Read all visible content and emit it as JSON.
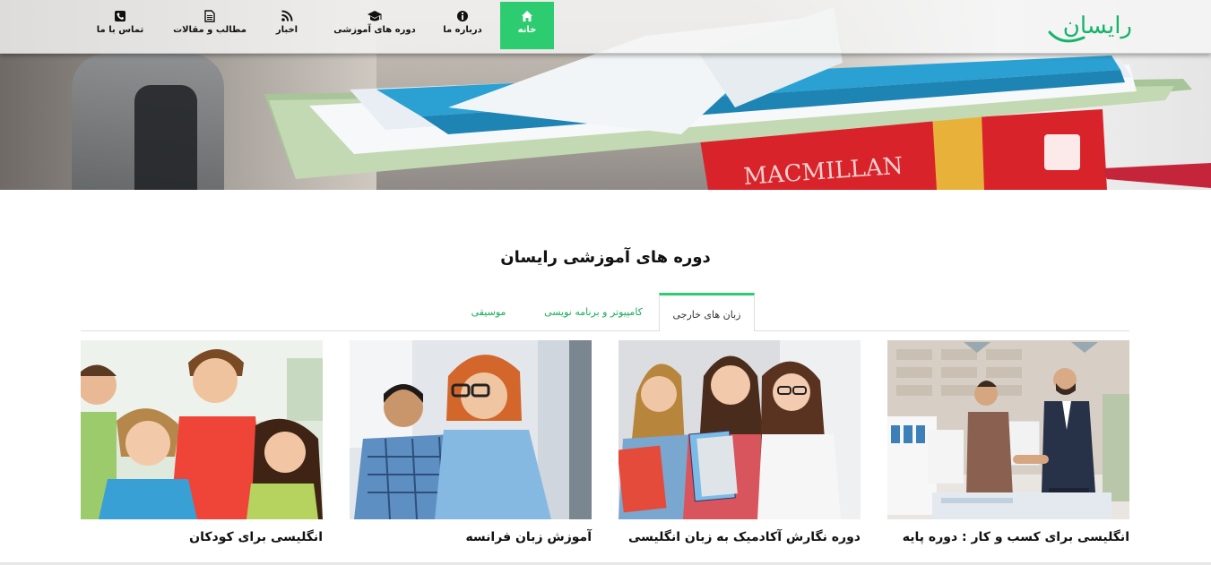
{
  "brand": {
    "logo_text": "رایسان",
    "accent": "#2ecc71"
  },
  "nav": {
    "home": "خانه",
    "about": "درباره ما",
    "courses": "دوره های آموزشی",
    "news": "اخبار",
    "articles": "مطالب و مقالات",
    "contact": "تماس با ما"
  },
  "hero": {
    "book_label": "MACMILLAN"
  },
  "section": {
    "title": "دوره های آموزشی رایسان"
  },
  "tabs": [
    {
      "label": "زبان های خارجی",
      "active": true
    },
    {
      "label": "کامپیوتر و برنامه نویسی",
      "active": false
    },
    {
      "label": "موسیقی",
      "active": false
    }
  ],
  "courses": [
    {
      "title": "انگلیسی برای کسب و کار : دوره پایه"
    },
    {
      "title": "دوره نگارش آکادمیک به زبان انگلیسی"
    },
    {
      "title": "آموزش زبان فرانسه"
    },
    {
      "title": "انگلیسی برای کودکان"
    }
  ]
}
